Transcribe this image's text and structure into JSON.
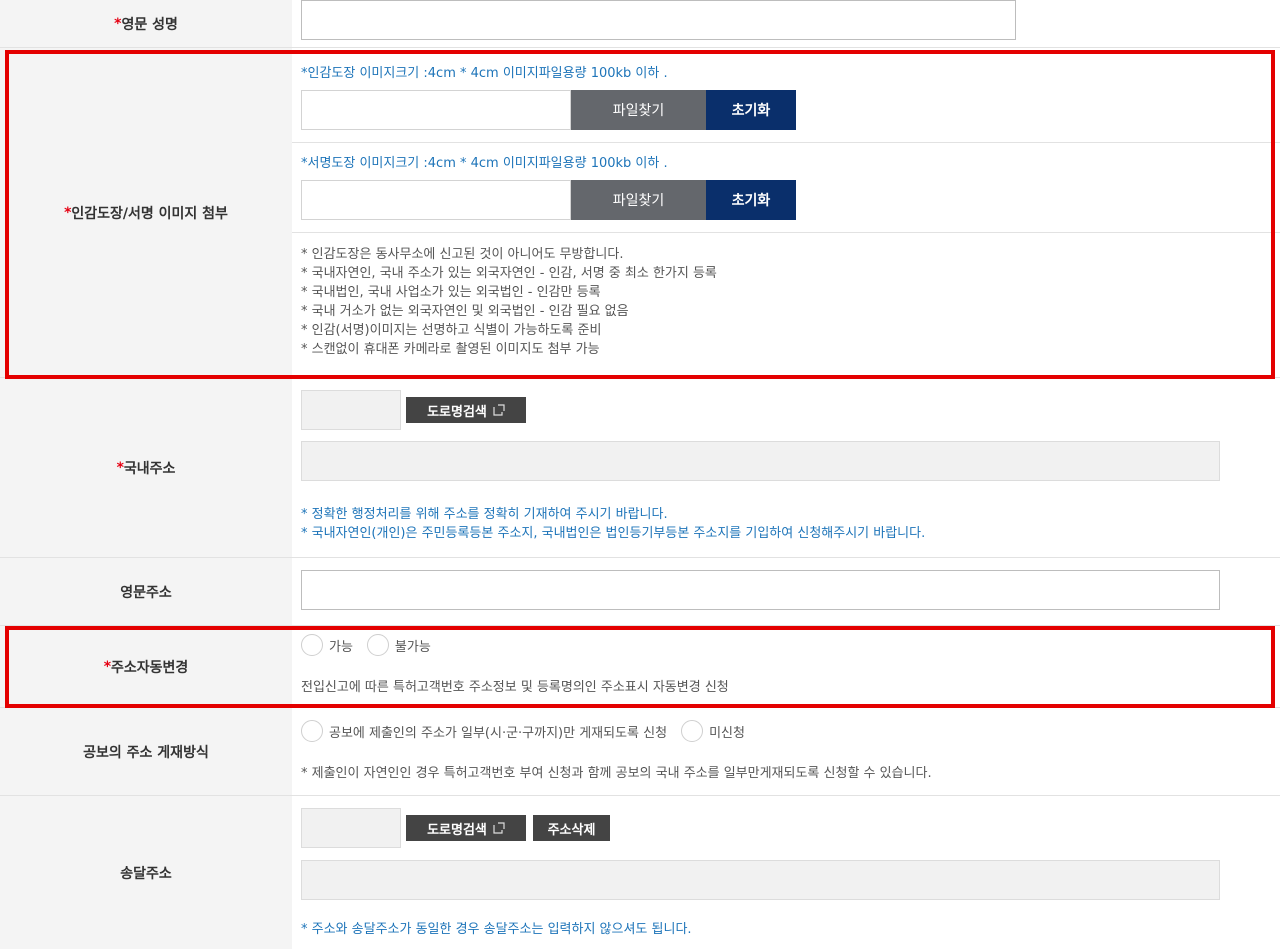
{
  "required_mark": "*",
  "english_name": {
    "label": "영문 성명"
  },
  "seal_attach": {
    "label": "인감도장/서명 이미지 첨부",
    "seal_spec": "*인감도장 이미지크기 :4cm * 4cm 이미지파일용량 100kb 이하 .",
    "signature_spec": "*서명도장 이미지크기 :4cm * 4cm 이미지파일용량 100kb 이하 .",
    "find_label": "파일찾기",
    "reset_label": "초기화",
    "notes": [
      "* 인감도장은 동사무소에 신고된 것이 아니어도 무방합니다.",
      "* 국내자연인, 국내 주소가 있는 외국자연인 - 인감, 서명 중 최소 한가지 등록",
      "* 국내법인, 국내 사업소가 있는 외국법인 - 인감만 등록",
      "* 국내 거소가 없는 외국자연인 및 외국법인 - 인감 필요 없음",
      "* 인감(서명)이미지는 선명하고 식별이 가능하도록 준비",
      "* 스캔없이 휴대폰 카메라로 촬영된 이미지도 첨부 가능"
    ]
  },
  "domestic_address": {
    "label": "국내주소",
    "search_label": "도로명검색",
    "notes": [
      "* 정확한 행정처리를 위해 주소를 정확히 기재하여 주시기 바랍니다.",
      "* 국내자연인(개인)은 주민등록등본 주소지, 국내법인은 법인등기부등본 주소지를 기입하여 신청해주시기 바랍니다."
    ]
  },
  "english_address": {
    "label": "영문주소"
  },
  "auto_change": {
    "label": "주소자동변경",
    "options": [
      "가능",
      "불가능"
    ],
    "description": "전입신고에 따른 특허고객번호 주소정보 및 등록명의인 주소표시 자동변경 신청"
  },
  "gazette": {
    "label": "공보의 주소 게재방식",
    "options": [
      "공보에 제출인의 주소가 일부(시·군·구까지)만 게재되도록 신청",
      "미신청"
    ],
    "note": "* 제출인이 자연인인 경우 특허고객번호 부여 신청과 함께 공보의 국내 주소를 일부만게재되도록 신청할 수 있습니다."
  },
  "delivery_address": {
    "label": "송달주소",
    "search_label": "도로명검색",
    "delete_label": "주소삭제",
    "note": "* 주소와 송달주소가 동일한 경우 송달주소는 입력하지 않으셔도 됩니다."
  },
  "colors": {
    "required": "#e60012",
    "highlight": "#e40000",
    "reset_button": "#0a2f6b",
    "find_button": "#64676c",
    "info_blue": "#1d74b9"
  }
}
